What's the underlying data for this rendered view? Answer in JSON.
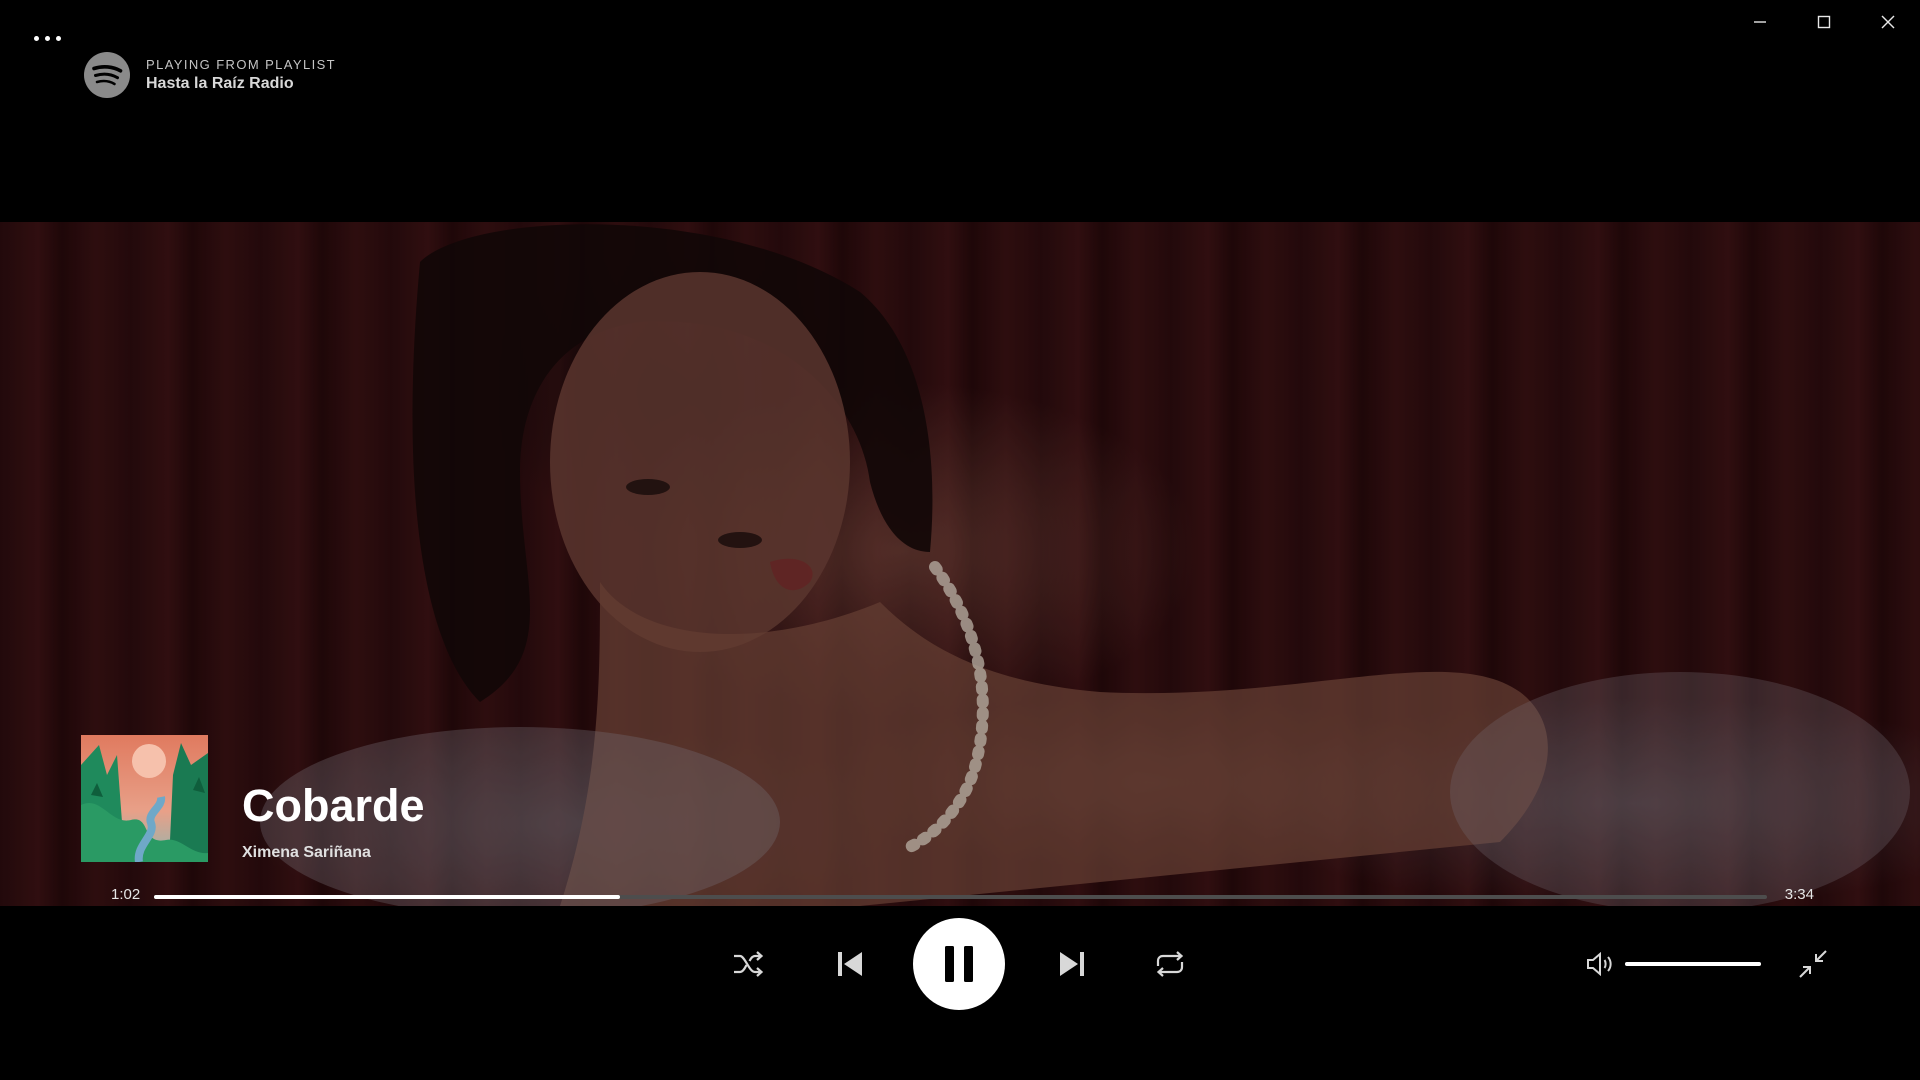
{
  "window": {
    "controls": [
      "minimize",
      "maximize",
      "close"
    ]
  },
  "context": {
    "label": "PLAYING FROM PLAYLIST",
    "name": "Hasta la Raíz Radio"
  },
  "track": {
    "title": "Cobarde",
    "artist": "Ximena Sariñana"
  },
  "playback": {
    "elapsed": "1:02",
    "duration": "3:34",
    "progress_fraction": 0.289,
    "state": "playing"
  },
  "volume": {
    "level_fraction": 1.0
  },
  "icons": {
    "more": "more-icon",
    "logo": "spotify-logo",
    "shuffle": "shuffle-icon",
    "previous": "skip-previous-icon",
    "play_pause": "pause-icon",
    "next": "skip-next-icon",
    "repeat": "repeat-icon",
    "volume": "volume-icon",
    "exit_fullscreen": "exit-fullscreen-icon"
  },
  "colors": {
    "background": "#000000",
    "progress_track": "#4d4d4d",
    "progress_fill": "#ffffff",
    "curtain": "#3b1214"
  }
}
